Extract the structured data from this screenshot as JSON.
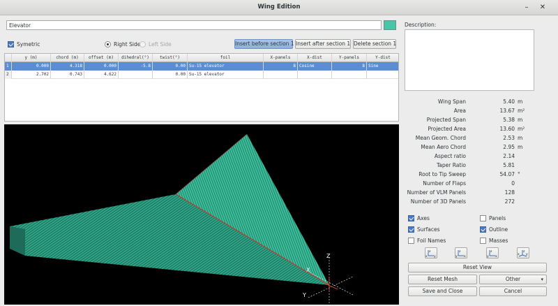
{
  "window": {
    "title": "Wing Edition",
    "min_icon": "minimize-icon",
    "close_icon": "close-icon"
  },
  "wing": {
    "name": "Elevator",
    "color": "#47c6a8"
  },
  "options": {
    "symetric": "Symetric",
    "right_side": "Right Side",
    "left_side": "Left Side"
  },
  "section_buttons": {
    "insert_before": "Insert before section 1",
    "insert_after": "Insert after section 1",
    "delete": "Delete section 1"
  },
  "table": {
    "headers": [
      "y (m)",
      "chord (m)",
      "offset (m)",
      "dihedral(°)",
      "twist(°)",
      "foil",
      "X-panels",
      "X-dist",
      "Y-panels",
      "Y-dist"
    ],
    "rows": [
      {
        "idx": "1",
        "y": "0.000",
        "chord": "4.318",
        "offset": "0.000",
        "dihedral": "-5.8",
        "twist": "0.00",
        "foil": "Su-15 elevator",
        "xpanels": "8",
        "xdist": "Cosine",
        "ypanels": "8",
        "ydist": "Sine"
      },
      {
        "idx": "2",
        "y": "2.702",
        "chord": "0.743",
        "offset": "4.622",
        "dihedral": "",
        "twist": "0.00",
        "foil": "Su-15 elevator",
        "xpanels": "",
        "xdist": "",
        "ypanels": "",
        "ydist": ""
      }
    ]
  },
  "description_label": "Description:",
  "stats": [
    {
      "label": "Wing Span",
      "value": "5.40",
      "unit": "m"
    },
    {
      "label": "Area",
      "value": "13.67",
      "unit": "m²"
    },
    {
      "label": "Projected Span",
      "value": "5.38",
      "unit": "m"
    },
    {
      "label": "Projected Area",
      "value": "13.60",
      "unit": "m²"
    },
    {
      "label": "Mean Geom. Chord",
      "value": "2.53",
      "unit": "m"
    },
    {
      "label": "Mean Aero Chord",
      "value": "2.95",
      "unit": "m"
    },
    {
      "label": "Aspect ratio",
      "value": "2.14",
      "unit": ""
    },
    {
      "label": "Taper Ratio",
      "value": "5.81",
      "unit": ""
    },
    {
      "label": "Root to Tip Sweep",
      "value": "54.07",
      "unit": "°"
    },
    {
      "label": "Number of Flaps",
      "value": "0",
      "unit": ""
    },
    {
      "label": "Number of VLM Panels",
      "value": "128",
      "unit": ""
    },
    {
      "label": "Number of 3D Panels",
      "value": "272",
      "unit": ""
    }
  ],
  "display": {
    "axes": "Axes",
    "panels": "Panels",
    "surfaces": "Surfaces",
    "outline": "Outline",
    "foil_names": "Foil Names",
    "masses": "Masses"
  },
  "view_buttons": [
    "view-x-icon",
    "view-y-icon",
    "view-z-icon",
    "view-iso-icon"
  ],
  "view_axis_letters": {
    "z": "z",
    "x": "x",
    "y": "y"
  },
  "axes_labels": {
    "x": "X",
    "y": "Y",
    "z": "Z"
  },
  "buttons": {
    "reset_view": "Reset View",
    "reset_mesh": "Reset Mesh",
    "other": "Other",
    "save_close": "Save and Close",
    "cancel": "Cancel"
  }
}
